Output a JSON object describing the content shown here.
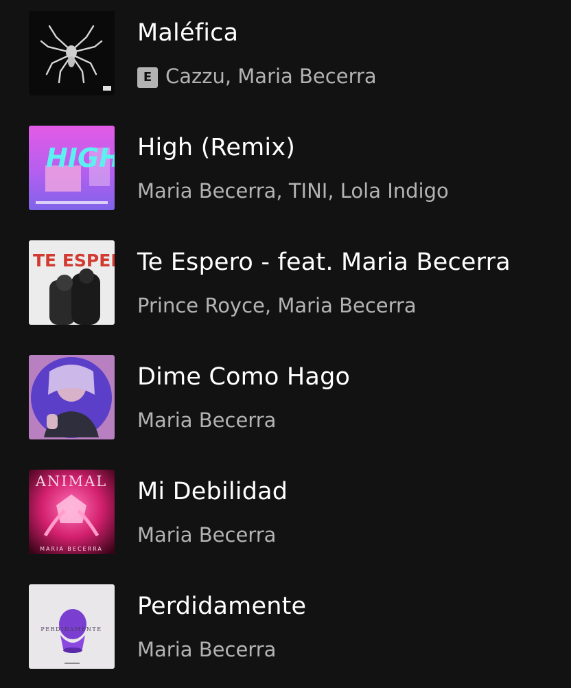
{
  "tracks": [
    {
      "title": "Maléfica",
      "artists": "Cazzu, Maria Becerra",
      "explicit": true,
      "explicit_label": "E",
      "cover_icon": "album-cover-malefica"
    },
    {
      "title": "High (Remix)",
      "artists": "Maria Becerra, TINI, Lola Indigo",
      "explicit": false,
      "cover_icon": "album-cover-high",
      "cover_text": "HIGH"
    },
    {
      "title": "Te Espero - feat. Maria Becerra",
      "artists": "Prince Royce, Maria Becerra",
      "explicit": false,
      "cover_icon": "album-cover-te-espero",
      "cover_text": "TE ESPERO"
    },
    {
      "title": "Dime Como Hago",
      "artists": "Maria Becerra",
      "explicit": false,
      "cover_icon": "album-cover-dime-como-hago"
    },
    {
      "title": "Mi Debilidad",
      "artists": "Maria Becerra",
      "explicit": false,
      "cover_icon": "album-cover-animal",
      "cover_text": "ANIMAL",
      "cover_subtext": "MARIA BECERRA"
    },
    {
      "title": "Perdidamente",
      "artists": "Maria Becerra",
      "explicit": false,
      "cover_icon": "album-cover-perdidamente",
      "cover_text": "PERDIDAMENTE"
    }
  ],
  "colors": {
    "background": "#121212",
    "title": "#ffffff",
    "subtitle": "#b3b3b3"
  }
}
